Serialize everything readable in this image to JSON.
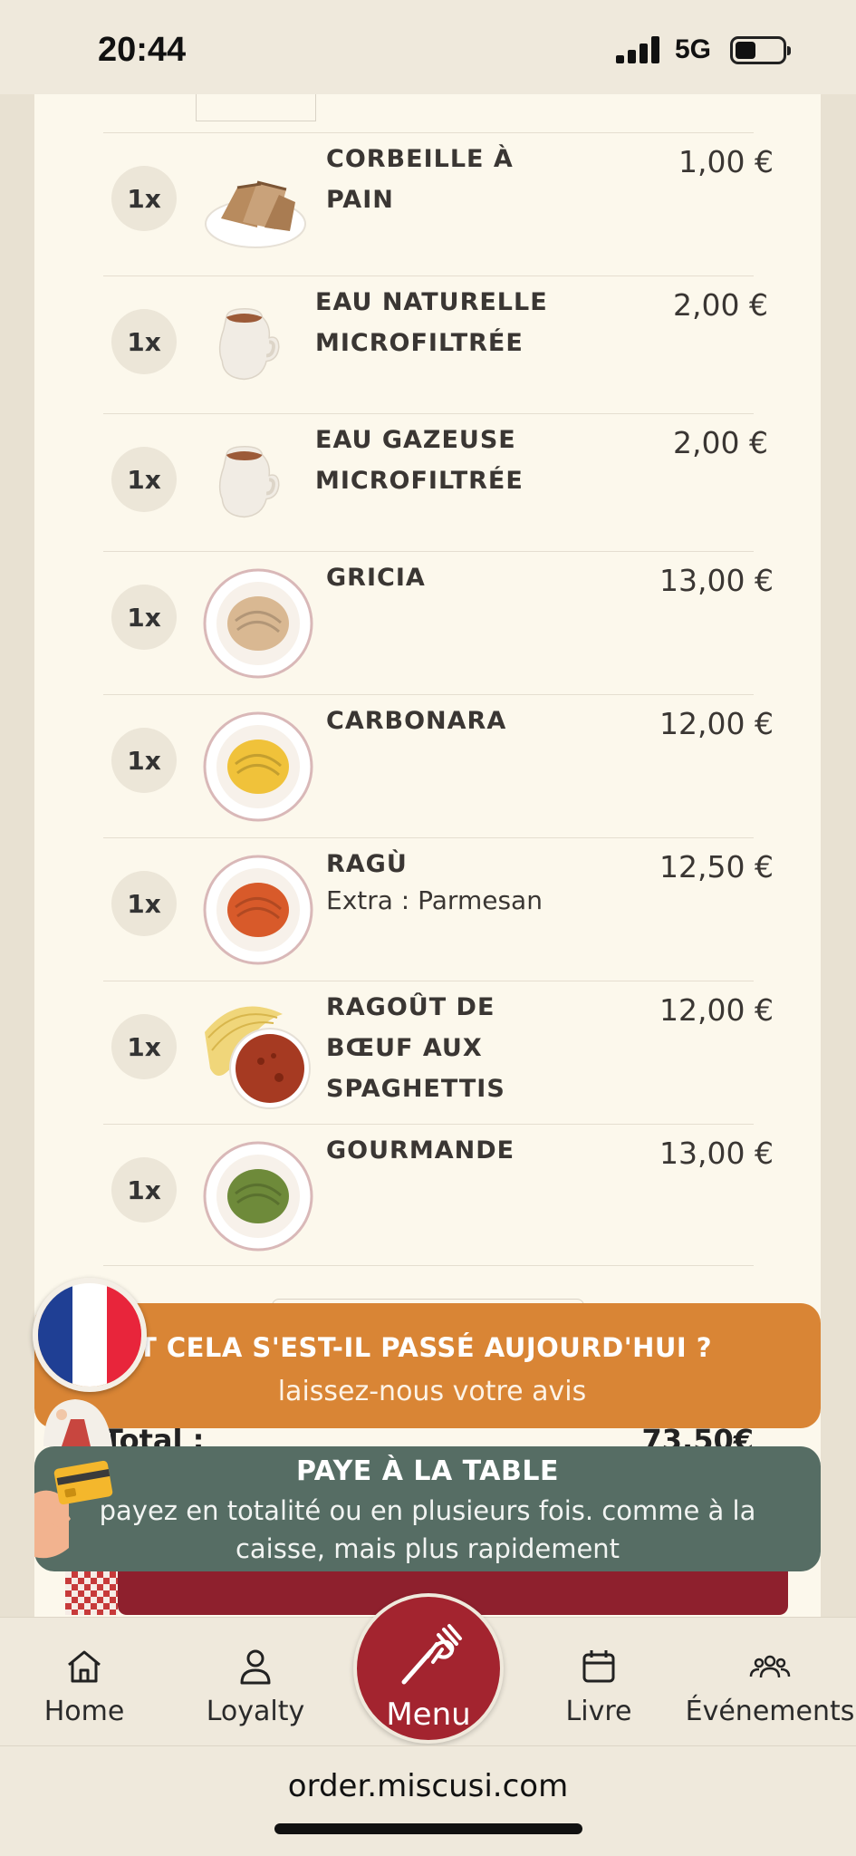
{
  "status_bar": {
    "time": "20:44",
    "network": "5G"
  },
  "order": {
    "items": [
      {
        "qty": "1x",
        "name": "CORBEILLE À PAIN",
        "price": "1,00 €",
        "thumb": "bread-basket",
        "extra": ""
      },
      {
        "qty": "1x",
        "name": "EAU NATURELLE MICROFILTRÉE",
        "price": "2,00 €",
        "thumb": "water-jug",
        "extra": ""
      },
      {
        "qty": "1x",
        "name": "EAU GAZEUSE MICROFILTRÉE",
        "price": "2,00 €",
        "thumb": "water-jug",
        "extra": ""
      },
      {
        "qty": "1x",
        "name": "GRICIA",
        "price": "13,00 €",
        "thumb": "pasta-plate",
        "extra": ""
      },
      {
        "qty": "1x",
        "name": "CARBONARA",
        "price": "12,00 €",
        "thumb": "pasta-plate",
        "extra": ""
      },
      {
        "qty": "1x",
        "name": "RAGÙ",
        "price": "12,50 €",
        "thumb": "pasta-plate",
        "extra": "Extra : Parmesan"
      },
      {
        "qty": "1x",
        "name": "RAGOÛT DE BŒUF AUX SPAGHETTIS",
        "price": "12,00 €",
        "thumb": "spaghetti-sauce",
        "extra": ""
      },
      {
        "qty": "1x",
        "name": "GOURMANDE",
        "price": "13,00 €",
        "thumb": "pasta-plate",
        "extra": ""
      }
    ],
    "total_label": "Total :",
    "total_value": "73,50€"
  },
  "feedback_banner": {
    "title": "ENT CELA S'EST-IL PASSÉ AUJOURD'HUI ?",
    "subtitle": "laissez-nous votre avis"
  },
  "pay_banner": {
    "title": "PAYE À LA TABLE",
    "subtitle": "payez en totalité ou en plusieurs fois. comme à la caisse, mais plus rapidement"
  },
  "nav": {
    "home": "Home",
    "loyalty": "Loyalty",
    "menu": "Menu",
    "livre": "Livre",
    "events": "Événements"
  },
  "browser": {
    "url": "order.miscusi.com"
  },
  "colors": {
    "feedback_bg": "#d98535",
    "pay_bg": "#566d64",
    "menu_fab": "#a3242f",
    "card_bg": "#fcf8ec"
  }
}
